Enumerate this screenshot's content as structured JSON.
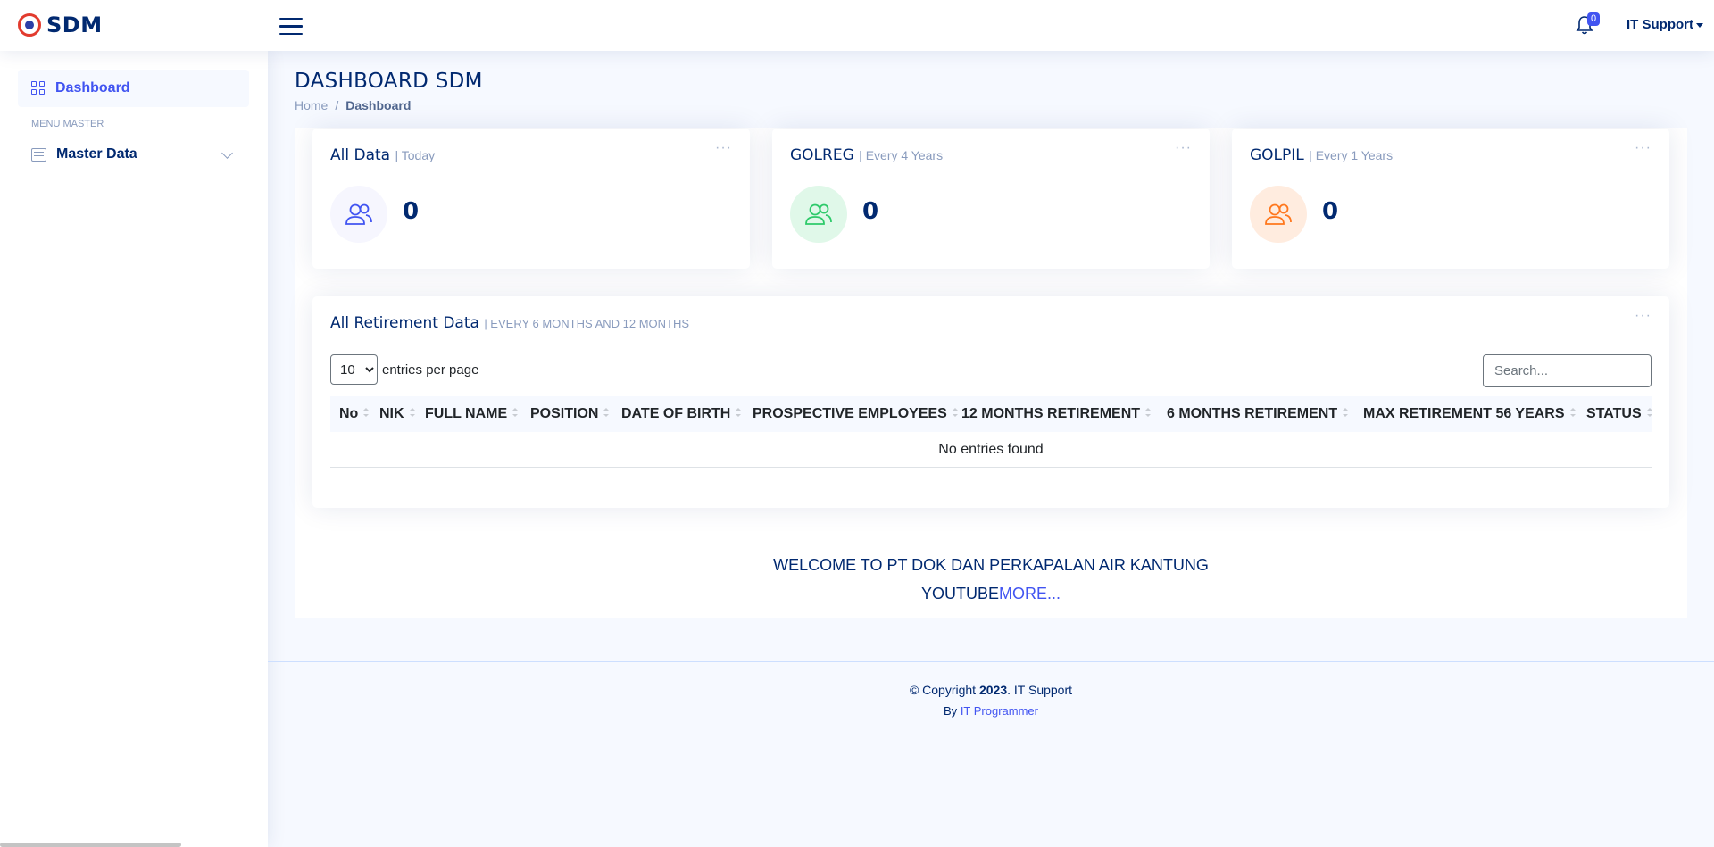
{
  "header": {
    "logo_text": "SDM",
    "notification_count": "0",
    "user_name": "IT Support"
  },
  "sidebar": {
    "dashboard_label": "Dashboard",
    "menu_heading": "MENU MASTER",
    "master_data_label": "Master Data"
  },
  "page": {
    "title": "DASHBOARD SDM",
    "breadcrumb": [
      "Home",
      "Dashboard"
    ]
  },
  "cards": [
    {
      "title": "All Data",
      "subtitle": "| Today",
      "value": "0",
      "color": "#4154f1"
    },
    {
      "title": "GOLREG",
      "subtitle": "| Every 4 Years",
      "value": "0",
      "color": "#2eca6a"
    },
    {
      "title": "GOLPIL",
      "subtitle": "| Every 1 Years",
      "value": "0",
      "color": "#ff771d"
    }
  ],
  "retirement": {
    "title": "All Retirement Data",
    "subtitle": "| EVERY 6 MONTHS AND 12 MONTHS",
    "page_size": "10",
    "entries_label": "entries per page",
    "search_placeholder": "Search...",
    "columns": [
      "No",
      "NIK",
      "FULL NAME",
      "POSITION",
      "DATE OF BIRTH",
      "PROSPECTIVE EMPLOYEES",
      "12 MONTHS RETIREMENT",
      "6 MONTHS RETIREMENT",
      "MAX RETIREMENT 56 YEARS",
      "STATUS"
    ],
    "empty_text": "No entries found"
  },
  "welcome": {
    "line1": "WELCOME TO PT DOK DAN PERKAPALAN AIR KANTUNG",
    "line2_prefix": "YOUTUBE",
    "line2_link": "MORE..."
  },
  "footer": {
    "copyright_prefix": "© Copyright ",
    "year": "2023",
    "copyright_suffix": ". IT Support",
    "by_prefix": "By ",
    "by_link": "IT Programmer"
  }
}
